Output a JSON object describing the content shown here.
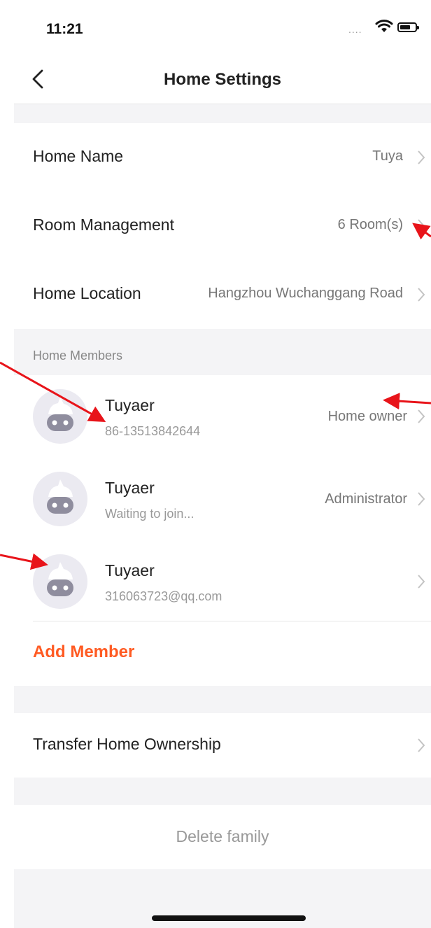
{
  "status_bar": {
    "time": "11:21",
    "signal": "....",
    "wifi_icon": "wifi-icon",
    "battery_icon": "battery-icon"
  },
  "nav": {
    "back_icon": "chevron-left-icon",
    "title": "Home Settings"
  },
  "home_info": [
    {
      "label": "Home Name",
      "value": "Tuya"
    },
    {
      "label": "Room Management",
      "value": "6 Room(s)"
    },
    {
      "label": "Home Location",
      "value": "Hangzhou Wuchanggang Road"
    }
  ],
  "members_section": {
    "header": "Home Members",
    "members": [
      {
        "name": "Tuyaer",
        "sub": "86-13513842644",
        "role": "Home owner"
      },
      {
        "name": "Tuyaer",
        "sub": "Waiting to join...",
        "role": "Administrator"
      },
      {
        "name": "Tuyaer",
        "sub": "316063723@qq.com",
        "role": ""
      }
    ],
    "add_member_label": "Add Member"
  },
  "transfer": {
    "label": "Transfer Home Ownership"
  },
  "delete": {
    "label": "Delete family"
  },
  "colors": {
    "accent": "#ff5b23",
    "annotation": "#e8141a",
    "background": "#f4f4f6"
  }
}
